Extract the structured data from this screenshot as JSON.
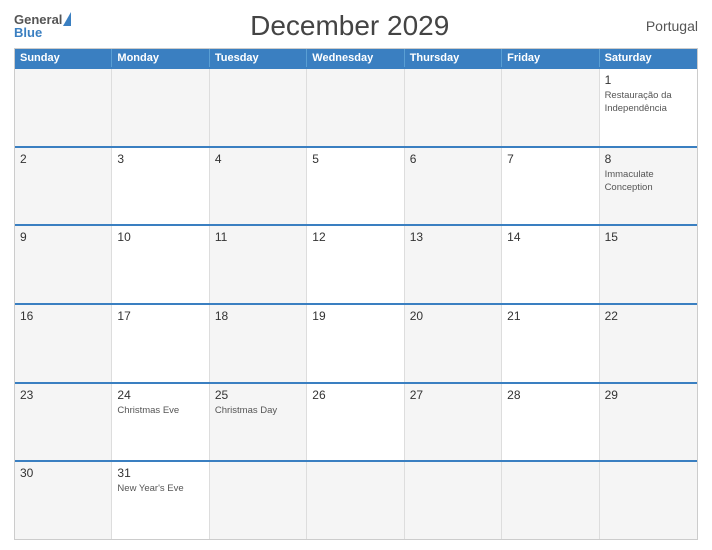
{
  "header": {
    "title": "December 2029",
    "country": "Portugal",
    "logo": {
      "general": "General",
      "blue": "Blue"
    }
  },
  "weekdays": [
    "Sunday",
    "Monday",
    "Tuesday",
    "Wednesday",
    "Thursday",
    "Friday",
    "Saturday"
  ],
  "rows": [
    [
      {
        "day": "",
        "holiday": "",
        "empty": true
      },
      {
        "day": "",
        "holiday": "",
        "empty": true
      },
      {
        "day": "",
        "holiday": "",
        "empty": true
      },
      {
        "day": "",
        "holiday": "",
        "empty": true
      },
      {
        "day": "",
        "holiday": "",
        "empty": true
      },
      {
        "day": "",
        "holiday": "",
        "empty": true
      },
      {
        "day": "1",
        "holiday": "Restauração da Independência",
        "empty": false
      }
    ],
    [
      {
        "day": "2",
        "holiday": "",
        "empty": false,
        "gray": true
      },
      {
        "day": "3",
        "holiday": "",
        "empty": false
      },
      {
        "day": "4",
        "holiday": "",
        "empty": false,
        "gray": true
      },
      {
        "day": "5",
        "holiday": "",
        "empty": false
      },
      {
        "day": "6",
        "holiday": "",
        "empty": false,
        "gray": true
      },
      {
        "day": "7",
        "holiday": "",
        "empty": false
      },
      {
        "day": "8",
        "holiday": "Immaculate Conception",
        "empty": false,
        "gray": true
      }
    ],
    [
      {
        "day": "9",
        "holiday": "",
        "empty": false,
        "gray": true
      },
      {
        "day": "10",
        "holiday": "",
        "empty": false
      },
      {
        "day": "11",
        "holiday": "",
        "empty": false,
        "gray": true
      },
      {
        "day": "12",
        "holiday": "",
        "empty": false
      },
      {
        "day": "13",
        "holiday": "",
        "empty": false,
        "gray": true
      },
      {
        "day": "14",
        "holiday": "",
        "empty": false
      },
      {
        "day": "15",
        "holiday": "",
        "empty": false,
        "gray": true
      }
    ],
    [
      {
        "day": "16",
        "holiday": "",
        "empty": false,
        "gray": true
      },
      {
        "day": "17",
        "holiday": "",
        "empty": false
      },
      {
        "day": "18",
        "holiday": "",
        "empty": false,
        "gray": true
      },
      {
        "day": "19",
        "holiday": "",
        "empty": false
      },
      {
        "day": "20",
        "holiday": "",
        "empty": false,
        "gray": true
      },
      {
        "day": "21",
        "holiday": "",
        "empty": false
      },
      {
        "day": "22",
        "holiday": "",
        "empty": false,
        "gray": true
      }
    ],
    [
      {
        "day": "23",
        "holiday": "",
        "empty": false,
        "gray": true
      },
      {
        "day": "24",
        "holiday": "Christmas Eve",
        "empty": false
      },
      {
        "day": "25",
        "holiday": "Christmas Day",
        "empty": false,
        "gray": true
      },
      {
        "day": "26",
        "holiday": "",
        "empty": false
      },
      {
        "day": "27",
        "holiday": "",
        "empty": false,
        "gray": true
      },
      {
        "day": "28",
        "holiday": "",
        "empty": false
      },
      {
        "day": "29",
        "holiday": "",
        "empty": false,
        "gray": true
      }
    ],
    [
      {
        "day": "30",
        "holiday": "",
        "empty": false,
        "gray": true
      },
      {
        "day": "31",
        "holiday": "New Year's Eve",
        "empty": false
      },
      {
        "day": "",
        "holiday": "",
        "empty": true
      },
      {
        "day": "",
        "holiday": "",
        "empty": true
      },
      {
        "day": "",
        "holiday": "",
        "empty": true
      },
      {
        "day": "",
        "holiday": "",
        "empty": true
      },
      {
        "day": "",
        "holiday": "",
        "empty": true
      }
    ]
  ]
}
